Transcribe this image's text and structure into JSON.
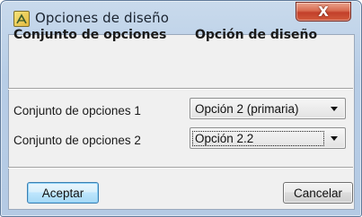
{
  "window": {
    "title": "Opciones de diseño",
    "close_glyph": "X"
  },
  "table": {
    "header_set": "Conjunto de opciones",
    "header_option": "Opción de diseño",
    "rows": [
      {
        "label": "Conjunto de opciones 1",
        "value": "Opción 2 (primaria)"
      },
      {
        "label": "Conjunto de opciones 2",
        "value": "Opción 2.2"
      }
    ]
  },
  "buttons": {
    "accept": "Aceptar",
    "cancel": "Cancelar"
  },
  "colors": {
    "titlebar": "#b9cfe7",
    "close_button": "#c8452e",
    "default_button_border": "#3c7fb1"
  },
  "icons": {
    "app_icon": "design-options-icon",
    "close_icon": "close-icon",
    "dropdown_icon": "chevron-down-icon"
  }
}
